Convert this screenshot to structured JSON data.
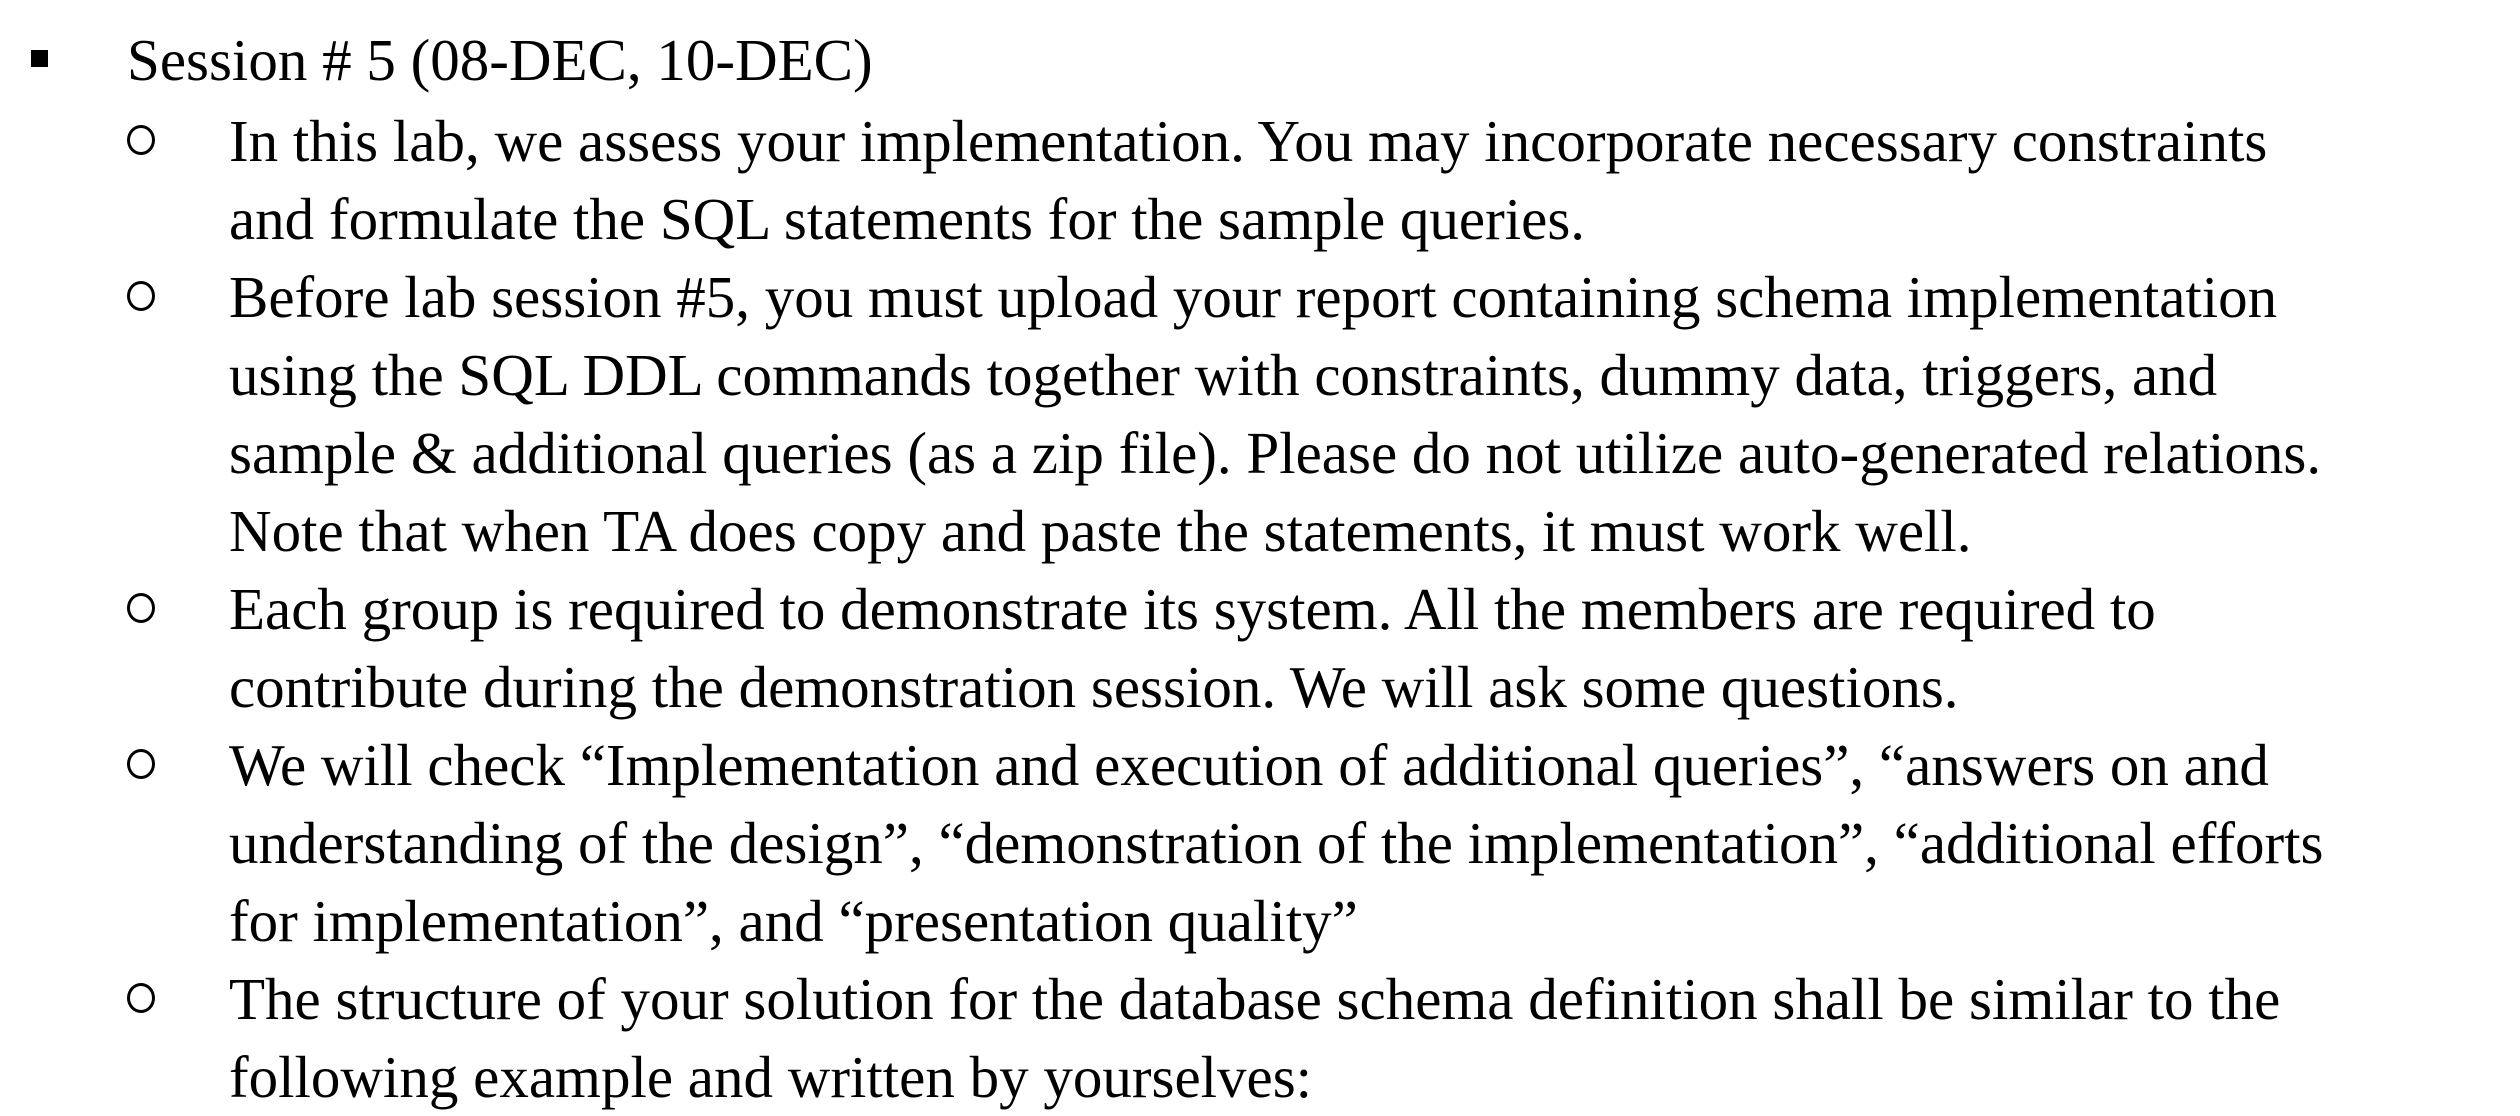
{
  "document": {
    "session_title": "Session # 5  (08-DEC, 10-DEC)",
    "items": [
      {
        "lines": [
          "In this lab, we assess your implementation. You may incorporate necessary constraints",
          "and formulate the SQL statements for the sample queries."
        ]
      },
      {
        "lines": [
          "Before lab session #5, you must upload your report containing schema implementation",
          "using the SQL DDL commands together with constraints, dummy data, triggers, and",
          "sample & additional queries (as a zip file). Please do not utilize auto-generated relations.",
          "Note that when TA does copy and paste the statements, it must work well."
        ]
      },
      {
        "lines": [
          "Each group is required to demonstrate its system. All the members are required to",
          "contribute during the demonstration session. We will ask some questions."
        ]
      },
      {
        "lines": [
          "We will check “Implementation and execution of additional queries”, “answers on and",
          "understanding of the design”, “demonstration of the implementation”, “additional efforts",
          "for implementation”, and “presentation quality”"
        ]
      },
      {
        "lines": [
          "The structure of your solution for the database schema definition shall be similar to the",
          "following example and written by yourselves:"
        ]
      }
    ]
  }
}
